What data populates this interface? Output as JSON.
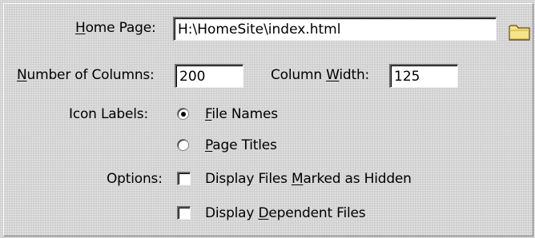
{
  "home_page": {
    "label_mnemonic": "H",
    "label_rest": "ome Page:",
    "value": "H:\\HomeSite\\index.html"
  },
  "columns": {
    "number_label_mnemonic": "N",
    "number_label_rest": "umber of Columns:",
    "number_value": "200",
    "width_label_before": "Column ",
    "width_label_mnemonic": "W",
    "width_label_after": "idth:",
    "width_value": "125"
  },
  "icon_labels": {
    "label": "Icon Labels:",
    "selected": "file_names",
    "file_names_mnemonic": "F",
    "file_names_rest": "ile Names",
    "page_titles_mnemonic": "P",
    "page_titles_rest": "age Titles"
  },
  "options": {
    "label": "Options:",
    "hidden_before": "Display Files ",
    "hidden_mnemonic": "M",
    "hidden_after": "arked as Hidden",
    "hidden_checked": false,
    "dependent_before": "Display ",
    "dependent_mnemonic": "D",
    "dependent_after": "ependent Files",
    "dependent_checked": false
  },
  "icons": {
    "browse": "folder-icon"
  }
}
